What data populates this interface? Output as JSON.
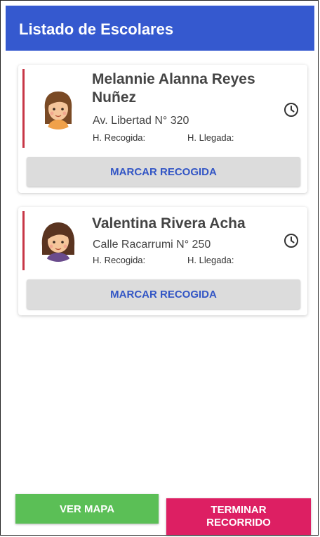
{
  "header": {
    "title": "Listado de Escolares"
  },
  "students": [
    {
      "name": "Melannie Alanna Reyes Nuñez",
      "address": "Av. Libertad N° 320",
      "pickup_label": "H. Recogida:",
      "arrival_label": "H. Llegada:",
      "button_label": "MARCAR RECOGIDA"
    },
    {
      "name": "Valentina Rivera Acha",
      "address": "Calle Racarrumi N° 250",
      "pickup_label": "H. Recogida:",
      "arrival_label": "H. Llegada:",
      "button_label": "MARCAR RECOGIDA"
    }
  ],
  "footer": {
    "map_label": "VER MAPA",
    "end_label_line1": "TERMINAR",
    "end_label_line2": "RECORRIDO"
  },
  "colors": {
    "appbar": "#3559cf",
    "accent": "#c73646",
    "map_button": "#5bbf56",
    "end_button": "#dd1f63"
  }
}
